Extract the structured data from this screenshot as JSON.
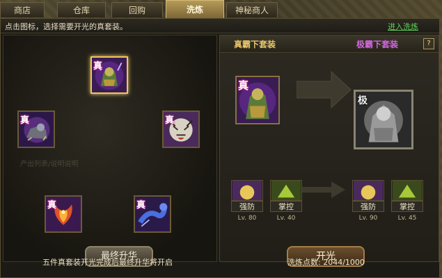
{
  "tabs": [
    {
      "label": "商店",
      "active": false
    },
    {
      "label": "仓库",
      "active": false
    },
    {
      "label": "回购",
      "active": false
    },
    {
      "label": "洗炼",
      "active": true
    },
    {
      "label": "神秘商人",
      "active": false
    }
  ],
  "hint": "点击图标，选择需要开光的真套装。",
  "enter_link": "进入洗炼",
  "left_panel": {
    "items": [
      {
        "badge": "真",
        "name": "dragon-beast"
      },
      {
        "badge": "真",
        "name": "dog-beast"
      },
      {
        "badge": "真",
        "name": "tiger-beast"
      },
      {
        "badge": "真",
        "name": "phoenix-beast"
      },
      {
        "badge": "真",
        "name": "blue-dragon-beast"
      }
    ],
    "watermark": "产出列表/说明说明",
    "final_button": "最终升华",
    "note": "五件真套装开光完成后最终升华将开启"
  },
  "right_panel": {
    "title_left": "真霸下套装",
    "title_right": "极霸下套装",
    "help": "?",
    "current_item_badge": "真",
    "target_item_badge": "极",
    "current_skills": [
      {
        "label": "强防",
        "level": "Lv. 80"
      },
      {
        "label": "掌控",
        "level": "Lv. 40"
      }
    ],
    "target_skills": [
      {
        "label": "强防",
        "level": "Lv. 90"
      },
      {
        "label": "掌控",
        "level": "Lv. 45"
      }
    ],
    "open_button": "开光",
    "points_label": "洗炼点数:",
    "points_value": "2044/1000"
  },
  "colors": {
    "gold_title": "#e7c46a",
    "purple_title": "#d067dc",
    "link_green": "#5fd35a",
    "selected_border": "#f0c65a"
  }
}
